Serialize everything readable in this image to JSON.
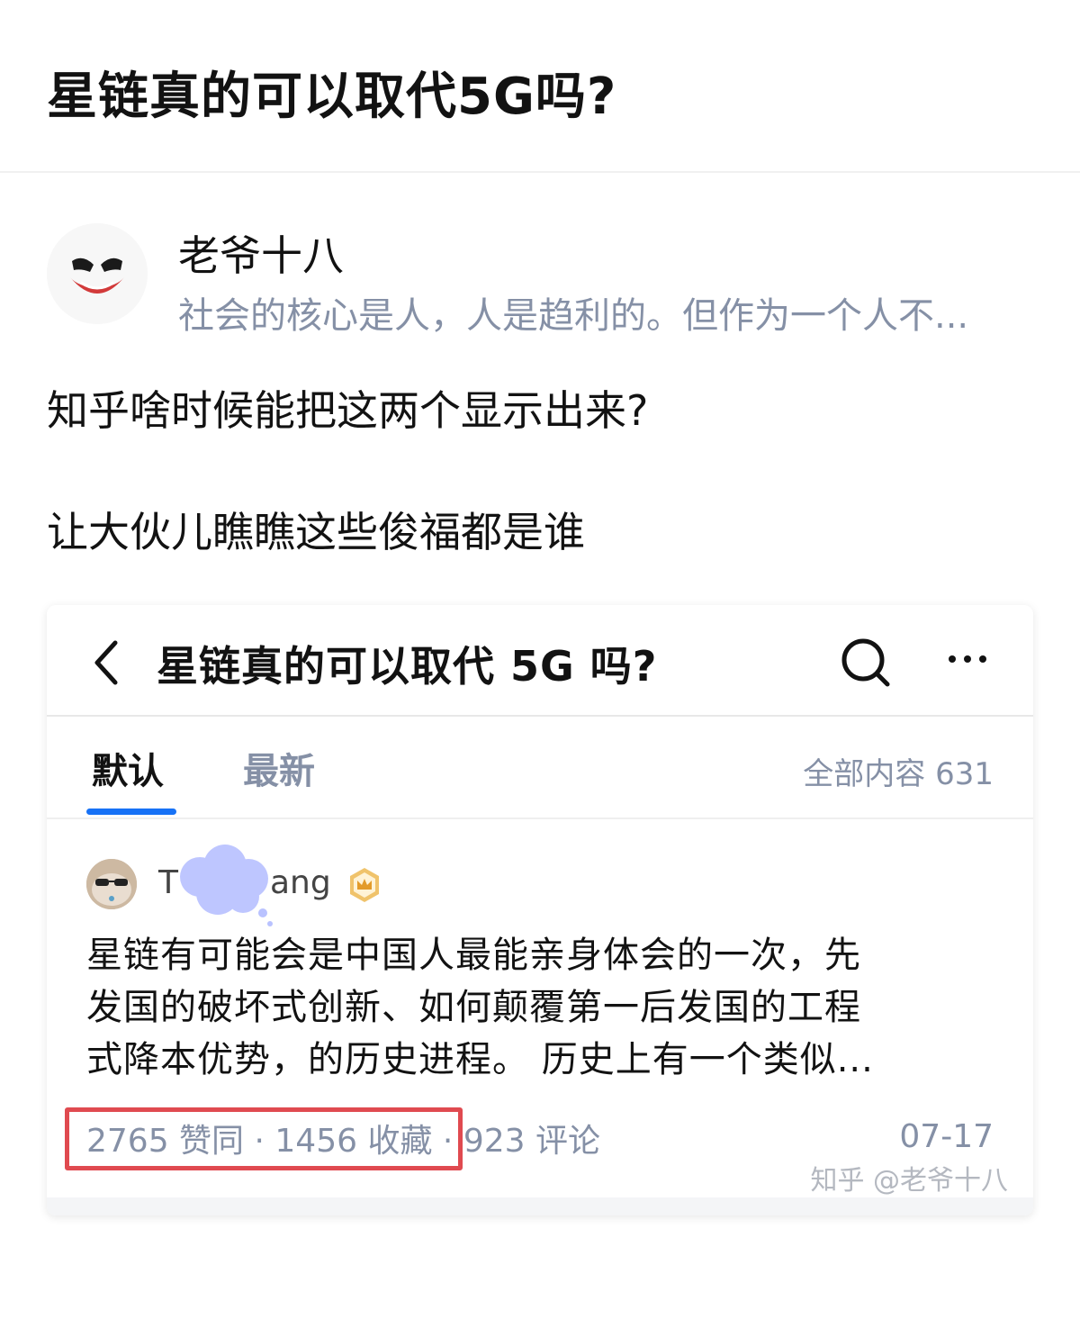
{
  "question": {
    "title": "星链真的可以取代5G吗?"
  },
  "author": {
    "name": "老爷十八",
    "bio": "社会的核心是人，人是趋利的。但作为一个人不..."
  },
  "post": {
    "paragraphs": [
      "知乎啥时候能把这两个显示出来?",
      "让大伙儿瞧瞧这些俊福都是谁"
    ]
  },
  "screenshot": {
    "nav": {
      "title": "星链真的可以取代 5G 吗?",
      "icons": [
        "back-icon",
        "search-icon",
        "more-icon"
      ]
    },
    "tabs": [
      {
        "label": "默认",
        "active": true
      },
      {
        "label": "最新",
        "active": false
      }
    ],
    "total_label": "全部内容 631",
    "answer": {
      "author_name_start": "T",
      "author_name_end": "ang",
      "badge_icon": "crown-badge-icon",
      "lines": [
        "星链有可能会是中国人最能亲身体会的一次，先",
        "发国的破坏式创新、如何颠覆第一后发国的工程",
        "式降本优势，的历史进程。 历史上有一个类似..."
      ],
      "upvotes": "2765 赞同",
      "separator": " · ",
      "favorites": "1456 收藏",
      "comments": "923 评论",
      "date": "07-17"
    },
    "watermark": "知乎 @老爷十八"
  },
  "colors": {
    "accent_blue": "#1772f6",
    "muted_text": "#8590a6",
    "highlight_red": "#e04a50"
  }
}
